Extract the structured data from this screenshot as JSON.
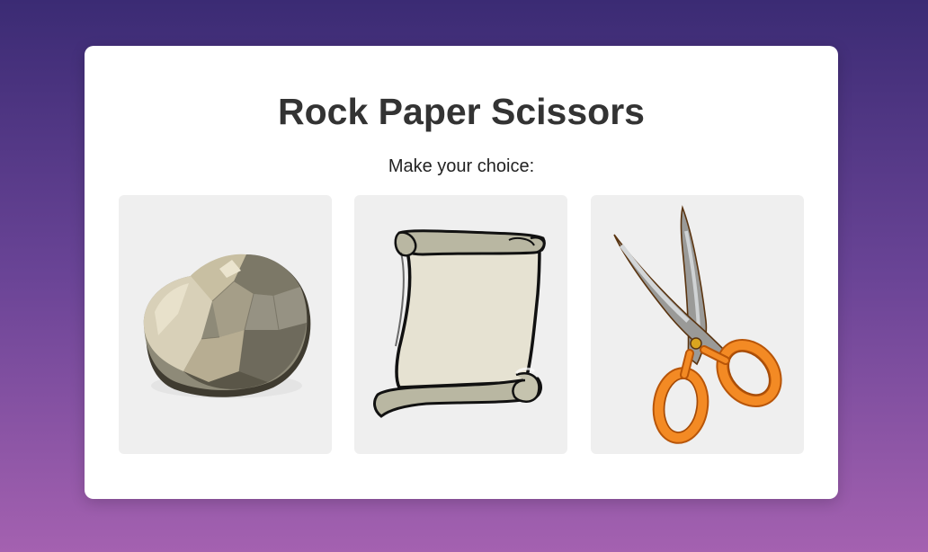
{
  "game": {
    "title": "Rock Paper Scissors",
    "prompt": "Make your choice:"
  },
  "choices": [
    {
      "id": "rock",
      "icon": "rock-icon"
    },
    {
      "id": "paper",
      "icon": "paper-scroll-icon"
    },
    {
      "id": "scissors",
      "icon": "scissors-icon"
    }
  ],
  "colors": {
    "background_top": "#3b2b74",
    "background_bottom": "#a461b0",
    "card": "#ffffff",
    "choice_tile": "#efefef",
    "scissors_handle": "#f07b1a"
  }
}
